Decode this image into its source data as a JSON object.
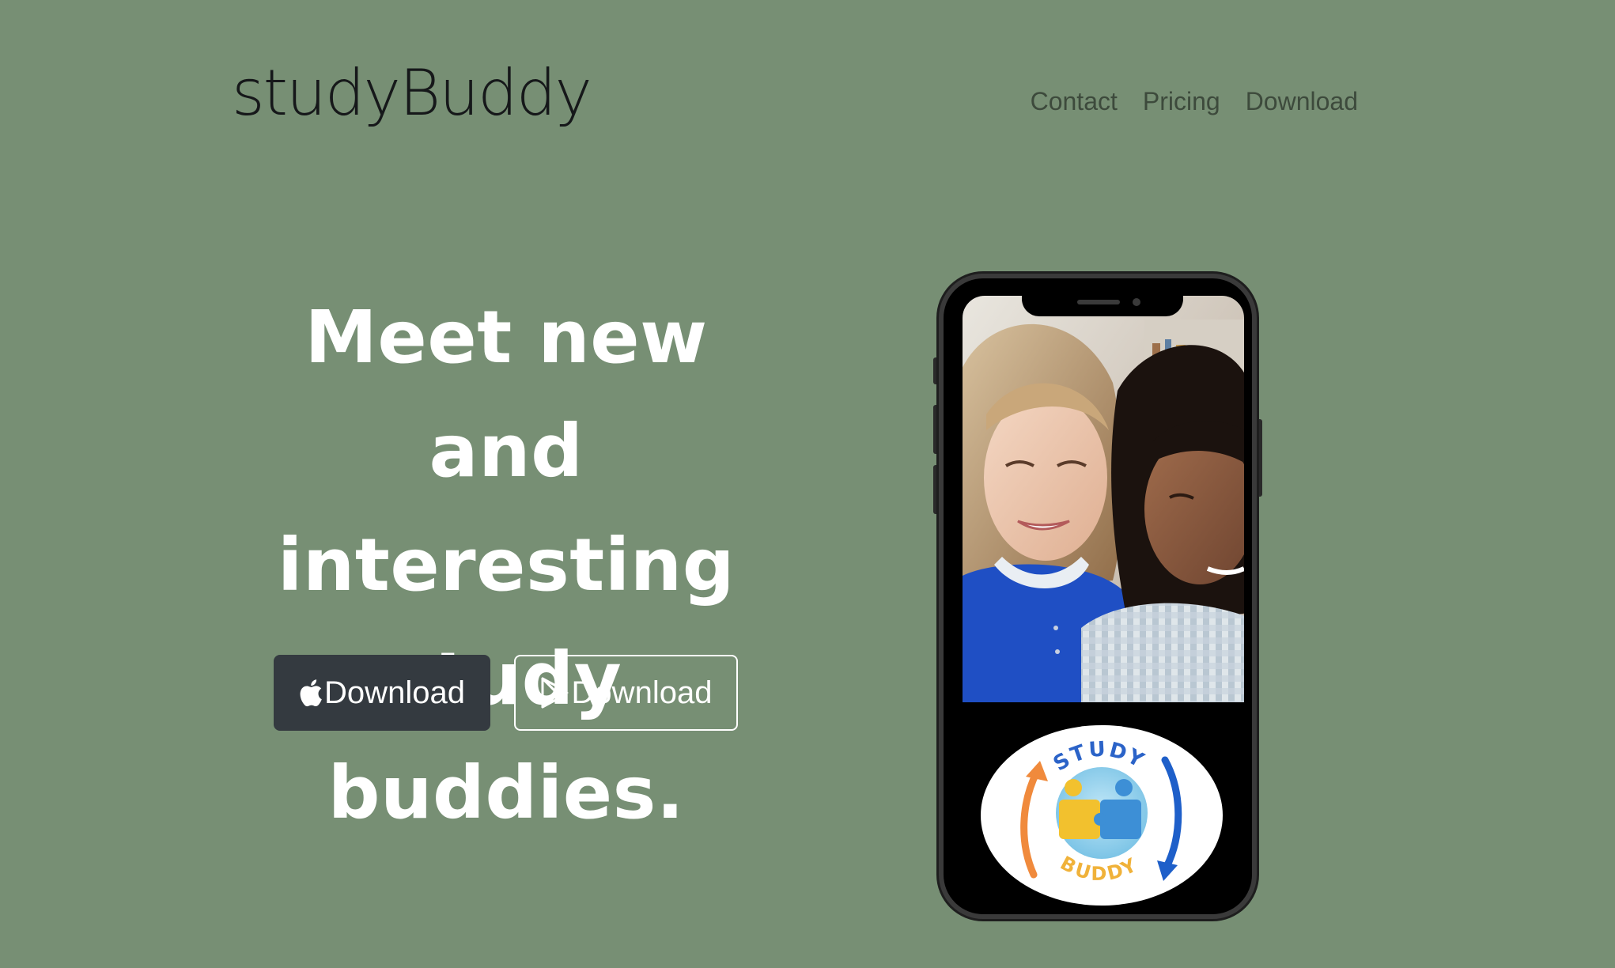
{
  "brand": {
    "name": "studyBuddy"
  },
  "nav": {
    "items": [
      "Contact",
      "Pricing",
      "Download"
    ]
  },
  "hero": {
    "title_lines": [
      "Meet new and",
      "interesting",
      "study buddies."
    ],
    "buttons": {
      "apple_label": "Download",
      "play_label": "Download"
    }
  },
  "phone": {
    "logo": {
      "top_text": "STUDY",
      "bottom_text": "BUDDY"
    }
  },
  "colors": {
    "background": "#778f74",
    "dark_button": "#343a40",
    "text_white": "#ffffff"
  },
  "icons": [
    "apple-icon",
    "google-play-icon"
  ]
}
